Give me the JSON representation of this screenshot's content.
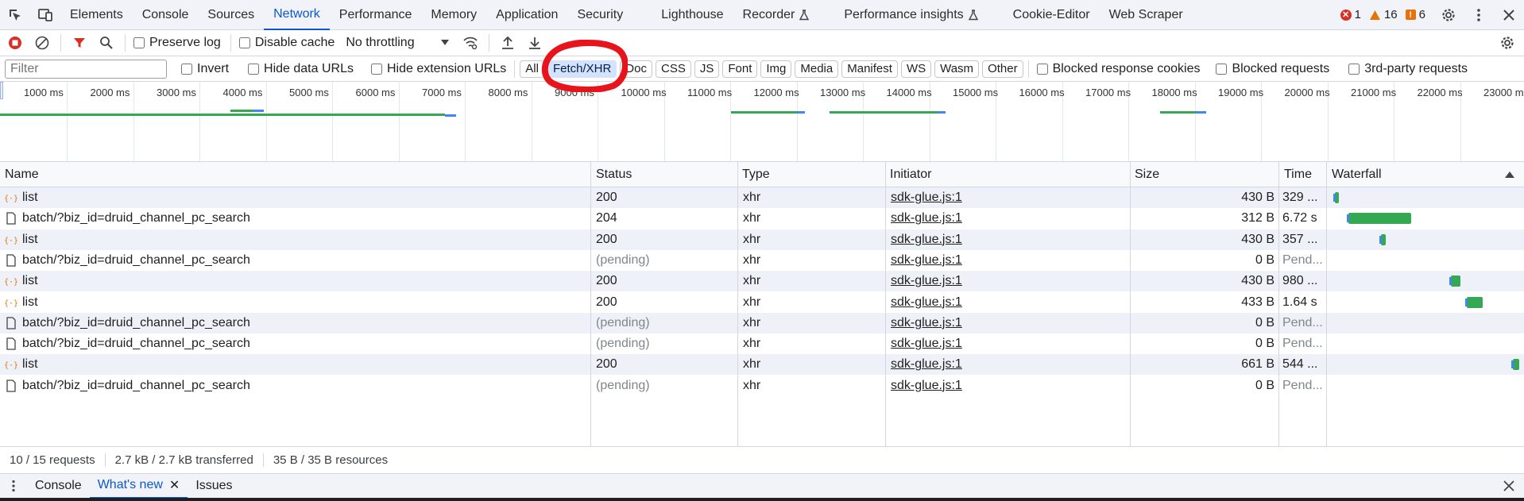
{
  "devtools": {
    "tabs": [
      {
        "label": "Elements"
      },
      {
        "label": "Console"
      },
      {
        "label": "Sources"
      },
      {
        "label": "Network",
        "active": true
      },
      {
        "label": "Performance"
      },
      {
        "label": "Memory"
      },
      {
        "label": "Application"
      },
      {
        "label": "Security"
      },
      {
        "label": "Lighthouse"
      },
      {
        "label": "Recorder"
      },
      {
        "label": "Performance insights"
      },
      {
        "label": "Cookie-Editor"
      },
      {
        "label": "Web Scraper"
      }
    ],
    "counts": {
      "errors": "1",
      "warnings": "16",
      "issues": "6"
    },
    "colors": {
      "error": "#d93025",
      "warning": "#e37400",
      "issue": "#e8710a",
      "accent": "#0b57d0",
      "waterfall": "#34a853",
      "annotation": "#e8141b"
    }
  },
  "toolbar": {
    "preserve_log": "Preserve log",
    "disable_cache": "Disable cache",
    "throttling": "No throttling"
  },
  "filter": {
    "placeholder": "Filter",
    "invert": "Invert",
    "hide_data_urls": "Hide data URLs",
    "hide_extension_urls": "Hide extension URLs",
    "types": [
      "All",
      "Fetch/XHR",
      "Doc",
      "CSS",
      "JS",
      "Font",
      "Img",
      "Media",
      "Manifest",
      "WS",
      "Wasm",
      "Other"
    ],
    "active_type": "Fetch/XHR",
    "blocked_cookies": "Blocked response cookies",
    "blocked_requests": "Blocked requests",
    "third_party": "3rd-party requests"
  },
  "overview": {
    "ticks": [
      "1000 ms",
      "2000 ms",
      "3000 ms",
      "4000 ms",
      "5000 ms",
      "6000 ms",
      "7000 ms",
      "8000 ms",
      "9000 ms",
      "10000 ms",
      "11000 ms",
      "12000 ms",
      "13000 ms",
      "14000 ms",
      "15000 ms",
      "16000 ms",
      "17000 ms",
      "18000 ms",
      "19000 ms",
      "20000 ms",
      "21000 ms",
      "22000 ms",
      "23000 ms"
    ]
  },
  "table": {
    "columns": {
      "name": "Name",
      "status": "Status",
      "type": "Type",
      "initiator": "Initiator",
      "size": "Size",
      "time": "Time",
      "waterfall": "Waterfall"
    },
    "rows": [
      {
        "kind": "xhr",
        "name": "list",
        "status": "200",
        "type": "xhr",
        "initiator": "sdk-glue.js:1",
        "size": "430 B",
        "time": "329 ..."
      },
      {
        "kind": "doc",
        "name": "batch/?biz_id=druid_channel_pc_search",
        "status": "204",
        "type": "xhr",
        "initiator": "sdk-glue.js:1",
        "size": "312 B",
        "time": "6.72 s"
      },
      {
        "kind": "xhr",
        "name": "list",
        "status": "200",
        "type": "xhr",
        "initiator": "sdk-glue.js:1",
        "size": "430 B",
        "time": "357 ..."
      },
      {
        "kind": "doc",
        "name": "batch/?biz_id=druid_channel_pc_search",
        "status": "(pending)",
        "type": "xhr",
        "initiator": "sdk-glue.js:1",
        "size": "0 B",
        "time": "Pend..."
      },
      {
        "kind": "xhr",
        "name": "list",
        "status": "200",
        "type": "xhr",
        "initiator": "sdk-glue.js:1",
        "size": "430 B",
        "time": "980 ..."
      },
      {
        "kind": "xhr",
        "name": "list",
        "status": "200",
        "type": "xhr",
        "initiator": "sdk-glue.js:1",
        "size": "433 B",
        "time": "1.64 s"
      },
      {
        "kind": "doc",
        "name": "batch/?biz_id=druid_channel_pc_search",
        "status": "(pending)",
        "type": "xhr",
        "initiator": "sdk-glue.js:1",
        "size": "0 B",
        "time": "Pend..."
      },
      {
        "kind": "doc",
        "name": "batch/?biz_id=druid_channel_pc_search",
        "status": "(pending)",
        "type": "xhr",
        "initiator": "sdk-glue.js:1",
        "size": "0 B",
        "time": "Pend..."
      },
      {
        "kind": "xhr",
        "name": "list",
        "status": "200",
        "type": "xhr",
        "initiator": "sdk-glue.js:1",
        "size": "661 B",
        "time": "544 ..."
      },
      {
        "kind": "doc",
        "name": "batch/?biz_id=druid_channel_pc_search",
        "status": "(pending)",
        "type": "xhr",
        "initiator": "sdk-glue.js:1",
        "size": "0 B",
        "time": "Pend..."
      }
    ]
  },
  "summary": {
    "requests": "10 / 15 requests",
    "transferred": "2.7 kB / 2.7 kB transferred",
    "resources": "35 B / 35 B resources"
  },
  "drawer": {
    "tabs": [
      {
        "label": "Console"
      },
      {
        "label": "What's new",
        "active": true
      },
      {
        "label": "Issues"
      }
    ]
  }
}
